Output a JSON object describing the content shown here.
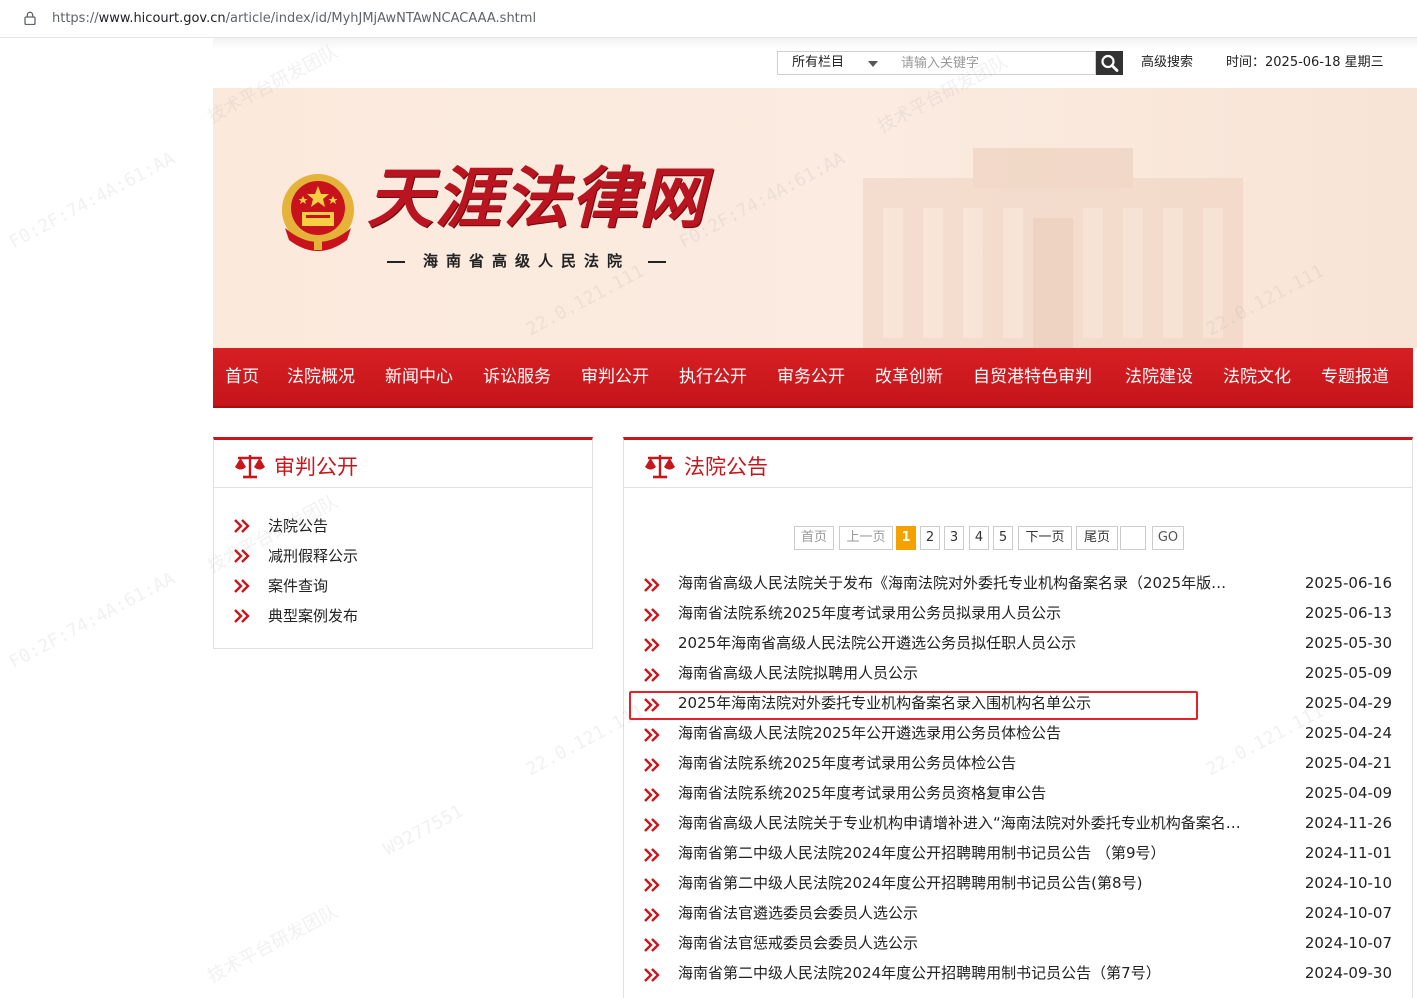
{
  "browser": {
    "url_scheme": "https://",
    "url_host": "www.hicourt.gov.cn",
    "url_path": "/article/index/id/MyhJMjAwNTAwNCACAAA.shtml"
  },
  "topbar": {
    "category_select": "所有栏目",
    "search_placeholder": "请输入关键字",
    "advanced_search": "高级搜索",
    "datetime": "时间：2025-06-18 星期三"
  },
  "banner": {
    "site_name": "天涯法律网",
    "subtitle": "海南省高级人民法院"
  },
  "nav": [
    "首页",
    "法院概况",
    "新闻中心",
    "诉讼服务",
    "审判公开",
    "执行公开",
    "审务公开",
    "改革创新",
    "自贸港特色审判",
    "法院建设",
    "法院文化",
    "专题报道"
  ],
  "sidebar": {
    "title": "审判公开",
    "items": [
      "法院公告",
      "减刑假释公示",
      "案件查询",
      "典型案例发布"
    ]
  },
  "main": {
    "title": "法院公告",
    "pager": {
      "first": "首页",
      "prev": "上一页",
      "pages": [
        "1",
        "2",
        "3",
        "4",
        "5"
      ],
      "current": "1",
      "next": "下一页",
      "last": "尾页",
      "go": "GO"
    },
    "news": [
      {
        "title": "海南省高级人民法院关于发布《海南法院对外委托专业机构备案名录（2025年版…",
        "date": "2025-06-16"
      },
      {
        "title": "海南省法院系统2025年度考试录用公务员拟录用人员公示",
        "date": "2025-06-13"
      },
      {
        "title": "2025年海南省高级人民法院公开遴选公务员拟任职人员公示",
        "date": "2025-05-30"
      },
      {
        "title": "海南省高级人民法院拟聘用人员公示",
        "date": "2025-05-09"
      },
      {
        "title": "2025年海南法院对外委托专业机构备案名录入围机构名单公示",
        "date": "2025-04-29"
      },
      {
        "title": "海南省高级人民法院2025年公开遴选录用公务员体检公告",
        "date": "2025-04-24"
      },
      {
        "title": "海南省法院系统2025年度考试录用公务员体检公告",
        "date": "2025-04-21"
      },
      {
        "title": "海南省法院系统2025年度考试录用公务员资格复审公告",
        "date": "2025-04-09"
      },
      {
        "title": "海南省高级人民法院关于专业机构申请增补进入“海南法院对外委托专业机构备案名…",
        "date": "2024-11-26"
      },
      {
        "title": "海南省第二中级人民法院2024年度公开招聘聘用制书记员公告 （第9号）",
        "date": "2024-11-01"
      },
      {
        "title": "海南省第二中级人民法院2024年度公开招聘聘用制书记员公告(第8号)",
        "date": "2024-10-10"
      },
      {
        "title": "海南省法官遴选委员会委员人选公示",
        "date": "2024-10-07"
      },
      {
        "title": "海南省法官惩戒委员会委员人选公示",
        "date": "2024-10-07"
      },
      {
        "title": "海南省第二中级人民法院2024年度公开招聘聘用制书记员公告（第7号）",
        "date": "2024-09-30"
      }
    ]
  },
  "colors": {
    "brand_red": "#c7161c",
    "nav_red": "#d61f23",
    "pager_active": "#f5a200",
    "highlight": "#e5222c"
  }
}
